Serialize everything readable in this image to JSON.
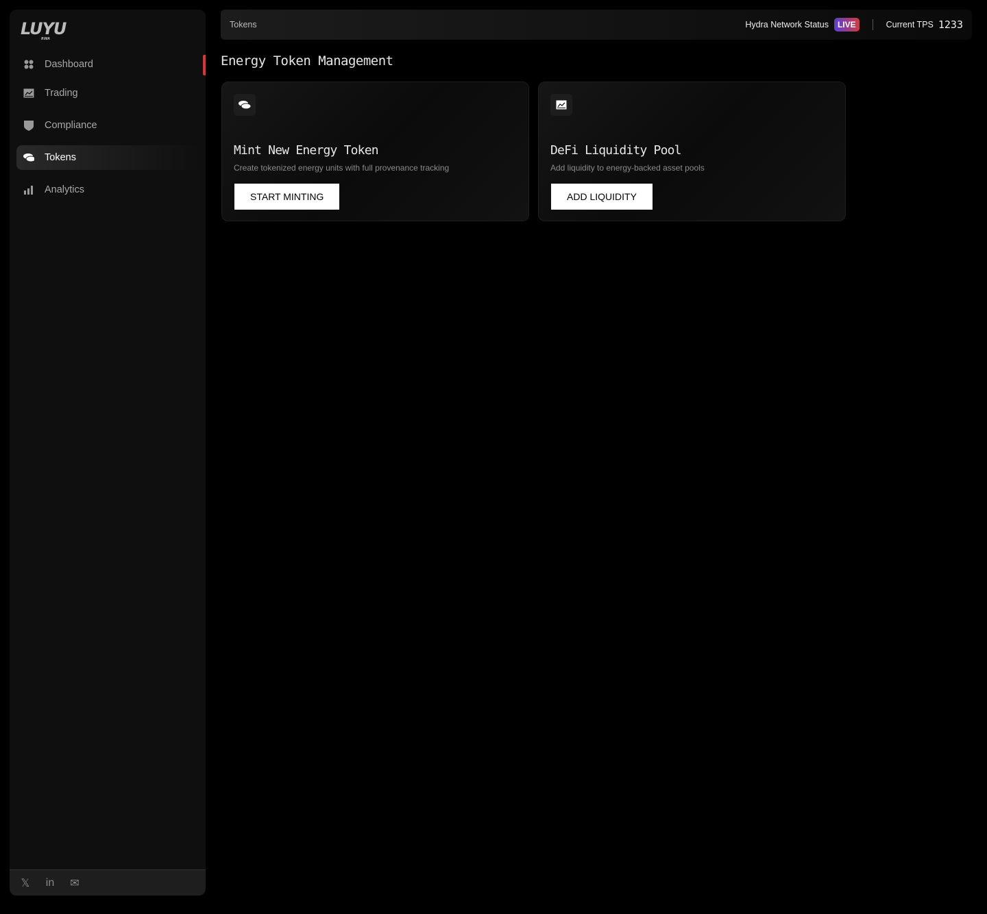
{
  "logo": {
    "text": "LUYU",
    "sub": "RWA"
  },
  "sidebar": {
    "items": [
      {
        "label": "Dashboard",
        "icon": "grid-icon"
      },
      {
        "label": "Trading",
        "icon": "chart-icon"
      },
      {
        "label": "Compliance",
        "icon": "shield-icon"
      },
      {
        "label": "Tokens",
        "icon": "coins-icon",
        "active": true
      },
      {
        "label": "Analytics",
        "icon": "bar-chart-icon"
      }
    ],
    "footer": {
      "x": "𝕏",
      "linkedin": "in",
      "mail": "✉"
    }
  },
  "topbar": {
    "breadcrumb": "Tokens",
    "status_label": "Hydra Network Status",
    "status_badge": "LIVE",
    "tps_label": "Current TPS",
    "tps_value": "1233"
  },
  "main": {
    "title": "Energy Token Management",
    "cards": [
      {
        "title": "Mint New Energy Token",
        "description": "Create tokenized energy units with full provenance tracking",
        "button": "START MINTING",
        "icon": "coins-icon"
      },
      {
        "title": "DeFi Liquidity Pool",
        "description": "Add liquidity to energy-backed asset pools",
        "button": "ADD LIQUIDITY",
        "icon": "chart-icon"
      }
    ]
  },
  "colors": {
    "accent": "#d33333",
    "live_from": "#5a3fd6",
    "live_to": "#d23b3b"
  }
}
